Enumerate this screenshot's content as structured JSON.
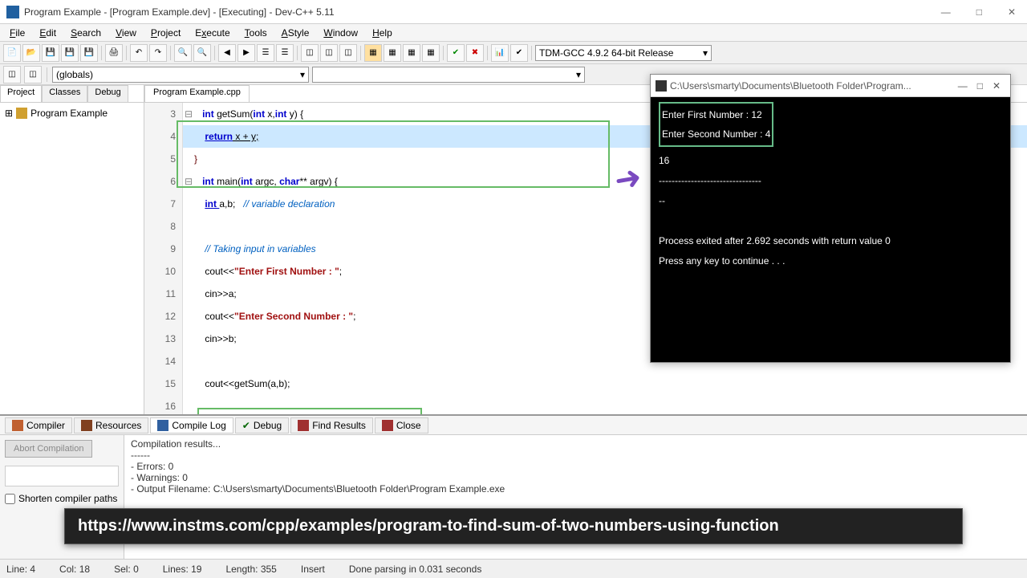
{
  "title": "Program Example - [Program Example.dev] - [Executing] - Dev-C++ 5.11",
  "menus": [
    "File",
    "Edit",
    "Search",
    "View",
    "Project",
    "Execute",
    "Tools",
    "AStyle",
    "Window",
    "Help"
  ],
  "compiler_combo": "TDM-GCC 4.9.2 64-bit Release",
  "globals_combo": "(globals)",
  "side_tabs": [
    "Project",
    "Classes",
    "Debug"
  ],
  "project_tree_item": "Program Example",
  "editor_tab": "Program Example.cpp",
  "code": {
    "l3": "int getSum(int x,int y) {",
    "l4": "    return x + y;",
    "l5": "}",
    "l6": "int main(int argc, char** argv) {",
    "l7": "    int a,b;   // variable declaration",
    "l8": "",
    "l9": "    // Taking input in variables",
    "l10": "    cout<<\"Enter First Number : \";",
    "l11": "    cin>>a;",
    "l12": "    cout<<\"Enter Second Number : \";",
    "l13": "    cin>>b;",
    "l14": "",
    "l15": "    cout<<getSum(a,b);"
  },
  "console": {
    "title": "C:\\Users\\smarty\\Documents\\Bluetooth Folder\\Program...",
    "line1": "Enter First Number : 12",
    "line2": "Enter Second Number : 4",
    "out": "16",
    "sep": "--------------------------------",
    "rest": "--\n\nProcess exited after 2.692 seconds with return value 0\nPress any key to continue . . ."
  },
  "bottom_tabs": [
    "Compiler",
    "Resources",
    "Compile Log",
    "Debug",
    "Find Results",
    "Close"
  ],
  "abort_btn": "Abort Compilation",
  "shorten_chk": "Shorten compiler paths",
  "compile_log": "Compilation results...\n------\n- Errors: 0\n- Warnings: 0\n- Output Filename: C:\\Users\\smarty\\Documents\\Bluetooth Folder\\Program Example.exe",
  "url_banner": "https://www.instms.com/cpp/examples/program-to-find-sum-of-two-numbers-using-function",
  "status": {
    "line": "Line:   4",
    "col": "Col:   18",
    "sel": "Sel:   0",
    "lines": "Lines:   19",
    "length": "Length:   355",
    "insert": "Insert",
    "parse": "Done parsing in 0.031 seconds"
  }
}
